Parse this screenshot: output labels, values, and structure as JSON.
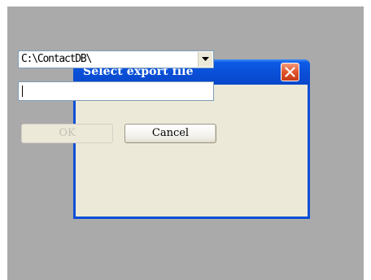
{
  "dialog": {
    "title": "Select export file",
    "close_icon": "close-x-icon",
    "folder_select": {
      "value": "C:\\ContactDB\\",
      "arrow_icon": "chevron-down-icon"
    },
    "filename_input": {
      "value": ""
    },
    "buttons": {
      "ok_label": "OK",
      "ok_enabled": false,
      "cancel_label": "Cancel"
    }
  },
  "colors": {
    "title_bar": "#0a4fd6",
    "close_button": "#e0542c",
    "client_background": "#ece9d8",
    "backdrop": "#aaaaaa"
  }
}
